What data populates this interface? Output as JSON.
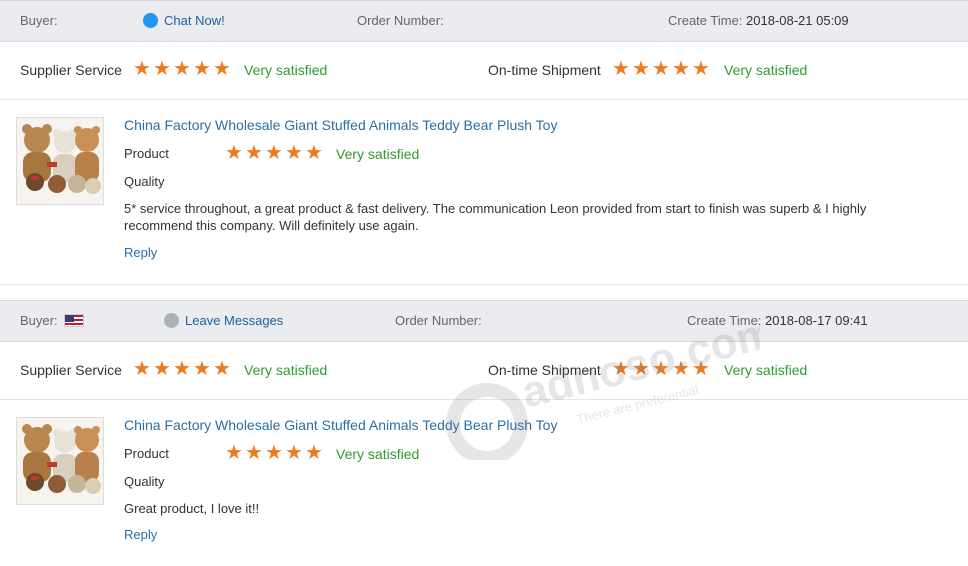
{
  "reviews": [
    {
      "buyer_label": "Buyer:",
      "contact_label": "Chat Now!",
      "order_label": "Order Number:",
      "create_label": "Create Time:",
      "create_time": "2018-08-21 05:09",
      "supplier_label": "Supplier Service",
      "supplier_stars": 5,
      "supplier_text": "Very satisfied",
      "shipment_label": "On-time Shipment",
      "shipment_stars": 5,
      "shipment_text": "Very satisfied",
      "product_title": "China Factory Wholesale Giant Stuffed Animals Teddy Bear Plush Toy",
      "product_label": "Product",
      "product_stars": 5,
      "product_text": "Very satisfied",
      "quality_label": "Quality",
      "comment": "5* service throughout, a great product & fast delivery. The communication Leon provided from start to finish was superb & I highly recommend this company. Will definitely use again.",
      "reply_label": "Reply"
    },
    {
      "buyer_label": "Buyer:",
      "contact_label": "Leave Messages",
      "order_label": "Order Number:",
      "create_label": "Create Time:",
      "create_time": "2018-08-17 09:41",
      "supplier_label": "Supplier Service",
      "supplier_stars": 5,
      "supplier_text": "Very satisfied",
      "shipment_label": "On-time Shipment",
      "shipment_stars": 5,
      "shipment_text": "Very satisfied",
      "product_title": "China Factory Wholesale Giant Stuffed Animals Teddy Bear Plush Toy",
      "product_label": "Product",
      "product_stars": 5,
      "product_text": "Very satisfied",
      "quality_label": "Quality",
      "comment": "Great product, I love it!!",
      "reply_label": "Reply"
    }
  ],
  "watermark": {
    "brand": "adnoso.com",
    "tagline": "There are preferential"
  },
  "colors": {
    "star": "#f07a1e",
    "satisfied": "#2e9b2e",
    "link": "#2a6fa8",
    "header_bg": "#eaecef"
  },
  "icons": {
    "chat": "chat-bubble-icon",
    "flag": "us-flag-icon",
    "star": "star-icon"
  }
}
